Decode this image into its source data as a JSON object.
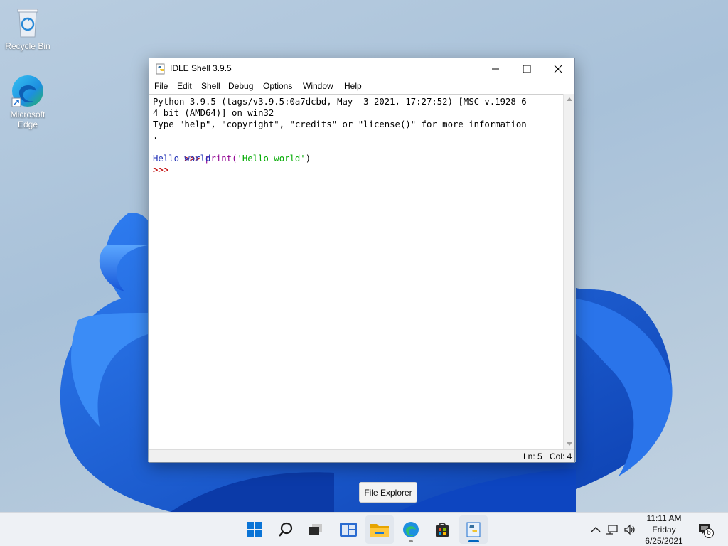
{
  "desktop": {
    "icons": [
      {
        "label": "Recycle Bin",
        "icon": "recycle-bin-icon"
      },
      {
        "label": "Microsoft Edge",
        "icon": "edge-icon"
      }
    ]
  },
  "window": {
    "title": "IDLE Shell 3.9.5",
    "menu": [
      "File",
      "Edit",
      "Shell",
      "Debug",
      "Options",
      "Window",
      "Help"
    ],
    "lines": [
      {
        "text": "Python 3.9.5 (tags/v3.9.5:0a7dcbd, May  3 2021, 17:27:52) [MSC v.1928 6",
        "color": "#000000"
      },
      {
        "text": "4 bit (AMD64)] on win32",
        "color": "#000000"
      },
      {
        "text": "Type \"help\", \"copyright\", \"credits\" or \"license()\" for more information",
        "color": "#000000"
      },
      {
        "text": ".",
        "color": "#000000"
      },
      {
        "prompt": ">>> ",
        "code_fn": "print(",
        "code_str": "'Hello world'",
        "code_end": ")"
      },
      {
        "text": "Hello world",
        "color": "#1f2fb5"
      },
      {
        "prompt": ">>> "
      }
    ],
    "status": {
      "line": "Ln: 5",
      "col": "Col: 4"
    }
  },
  "tooltip": "File Explorer",
  "taskbar": {
    "apps": [
      "start-icon",
      "search-icon",
      "task-view-icon",
      "widgets-icon",
      "file-explorer-icon",
      "edge-icon",
      "store-icon",
      "idle-icon"
    ],
    "clock": {
      "time": "11:11 AM",
      "day": "Friday",
      "date": "6/25/2021"
    },
    "notification_count": "6"
  },
  "colors": {
    "prompt": "#c00000",
    "builtin": "#900090",
    "string": "#00aa00",
    "output": "#1f2fb5",
    "accent": "#0067c0"
  }
}
